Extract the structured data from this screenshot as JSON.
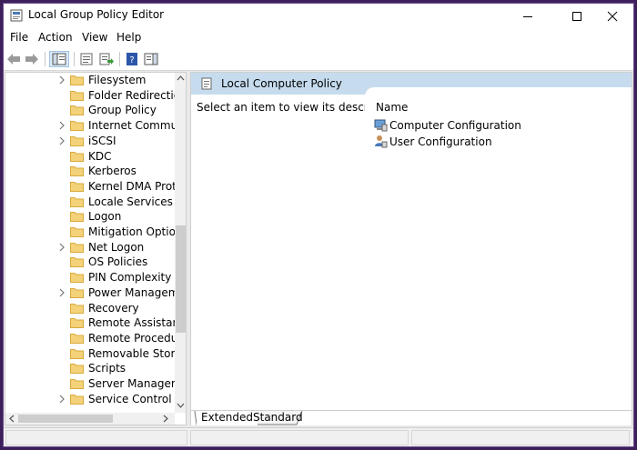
{
  "window": {
    "title": "Local Group Policy Editor"
  },
  "menu": [
    "File",
    "Action",
    "View",
    "Help"
  ],
  "tree": {
    "items": [
      {
        "label": "Filesystem",
        "expandable": true
      },
      {
        "label": "Folder Redirection",
        "expandable": false
      },
      {
        "label": "Group Policy",
        "expandable": false
      },
      {
        "label": "Internet Communi",
        "expandable": true
      },
      {
        "label": "iSCSI",
        "expandable": true
      },
      {
        "label": "KDC",
        "expandable": false
      },
      {
        "label": "Kerberos",
        "expandable": false
      },
      {
        "label": "Kernel DMA Protec",
        "expandable": false
      },
      {
        "label": "Locale Services",
        "expandable": false
      },
      {
        "label": "Logon",
        "expandable": false
      },
      {
        "label": "Mitigation Options",
        "expandable": false
      },
      {
        "label": "Net Logon",
        "expandable": true
      },
      {
        "label": "OS Policies",
        "expandable": false
      },
      {
        "label": "PIN Complexity",
        "expandable": false
      },
      {
        "label": "Power Managemer",
        "expandable": true
      },
      {
        "label": "Recovery",
        "expandable": false
      },
      {
        "label": "Remote Assistance",
        "expandable": false
      },
      {
        "label": "Remote Procedure",
        "expandable": false
      },
      {
        "label": "Removable Storage",
        "expandable": false
      },
      {
        "label": "Scripts",
        "expandable": false
      },
      {
        "label": "Server Manager",
        "expandable": false
      },
      {
        "label": "Service Control Ma",
        "expandable": true
      }
    ]
  },
  "detail": {
    "header_title": "Local Computer Policy",
    "description": "Select an item to view its description.",
    "column_name": "Name",
    "items": [
      "Computer Configuration",
      "User Configuration"
    ]
  },
  "tabs": [
    "Extended",
    "Standard"
  ],
  "colors": {
    "header_bg": "#c6dcee",
    "folder": "#f3d27a",
    "folder_edge": "#d9a93a"
  }
}
